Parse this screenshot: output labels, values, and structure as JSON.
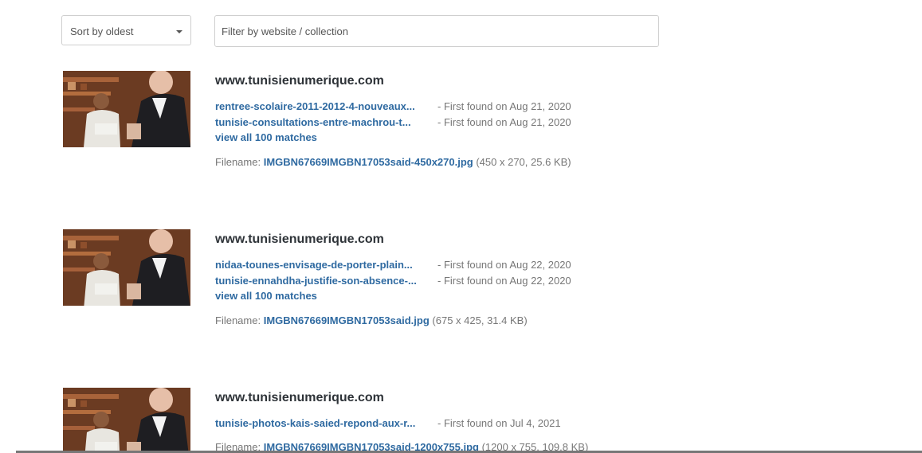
{
  "toolbar": {
    "sort_label": "Sort by oldest",
    "filter_placeholder": "Filter by website / collection"
  },
  "results": [
    {
      "site": "www.tunisienumerique.com",
      "matches": [
        {
          "link": "rentree-scolaire-2011-2012-4-nouveaux...",
          "found": "- First found on Aug 21, 2020"
        },
        {
          "link": "tunisie-consultations-entre-machrou-t...",
          "found": "- First found on Aug 21, 2020"
        }
      ],
      "view_all": "view all 100 matches",
      "filename_label": "Filename:",
      "filename": "IMGBN67669IMGBN17053said-450x270.jpg",
      "file_meta": "(450 x 270, 25.6 KB)"
    },
    {
      "site": "www.tunisienumerique.com",
      "matches": [
        {
          "link": "nidaa-tounes-envisage-de-porter-plain...",
          "found": "- First found on Aug 22, 2020"
        },
        {
          "link": "tunisie-ennahdha-justifie-son-absence-...",
          "found": "- First found on Aug 22, 2020"
        }
      ],
      "view_all": "view all 100 matches",
      "filename_label": "Filename:",
      "filename": "IMGBN67669IMGBN17053said.jpg",
      "file_meta": "(675 x 425, 31.4 KB)"
    },
    {
      "site": "www.tunisienumerique.com",
      "matches": [
        {
          "link": "tunisie-photos-kais-saied-repond-aux-r...",
          "found": "- First found on Jul 4, 2021"
        }
      ],
      "filename_label": "Filename:",
      "filename": "IMGBN67669IMGBN17053said-1200x755.jpg",
      "file_meta": "(1200 x 755, 109.8 KB)"
    }
  ],
  "colors": {
    "link": "#2f6aa1",
    "muted": "#777777",
    "heading": "#2e3338"
  }
}
